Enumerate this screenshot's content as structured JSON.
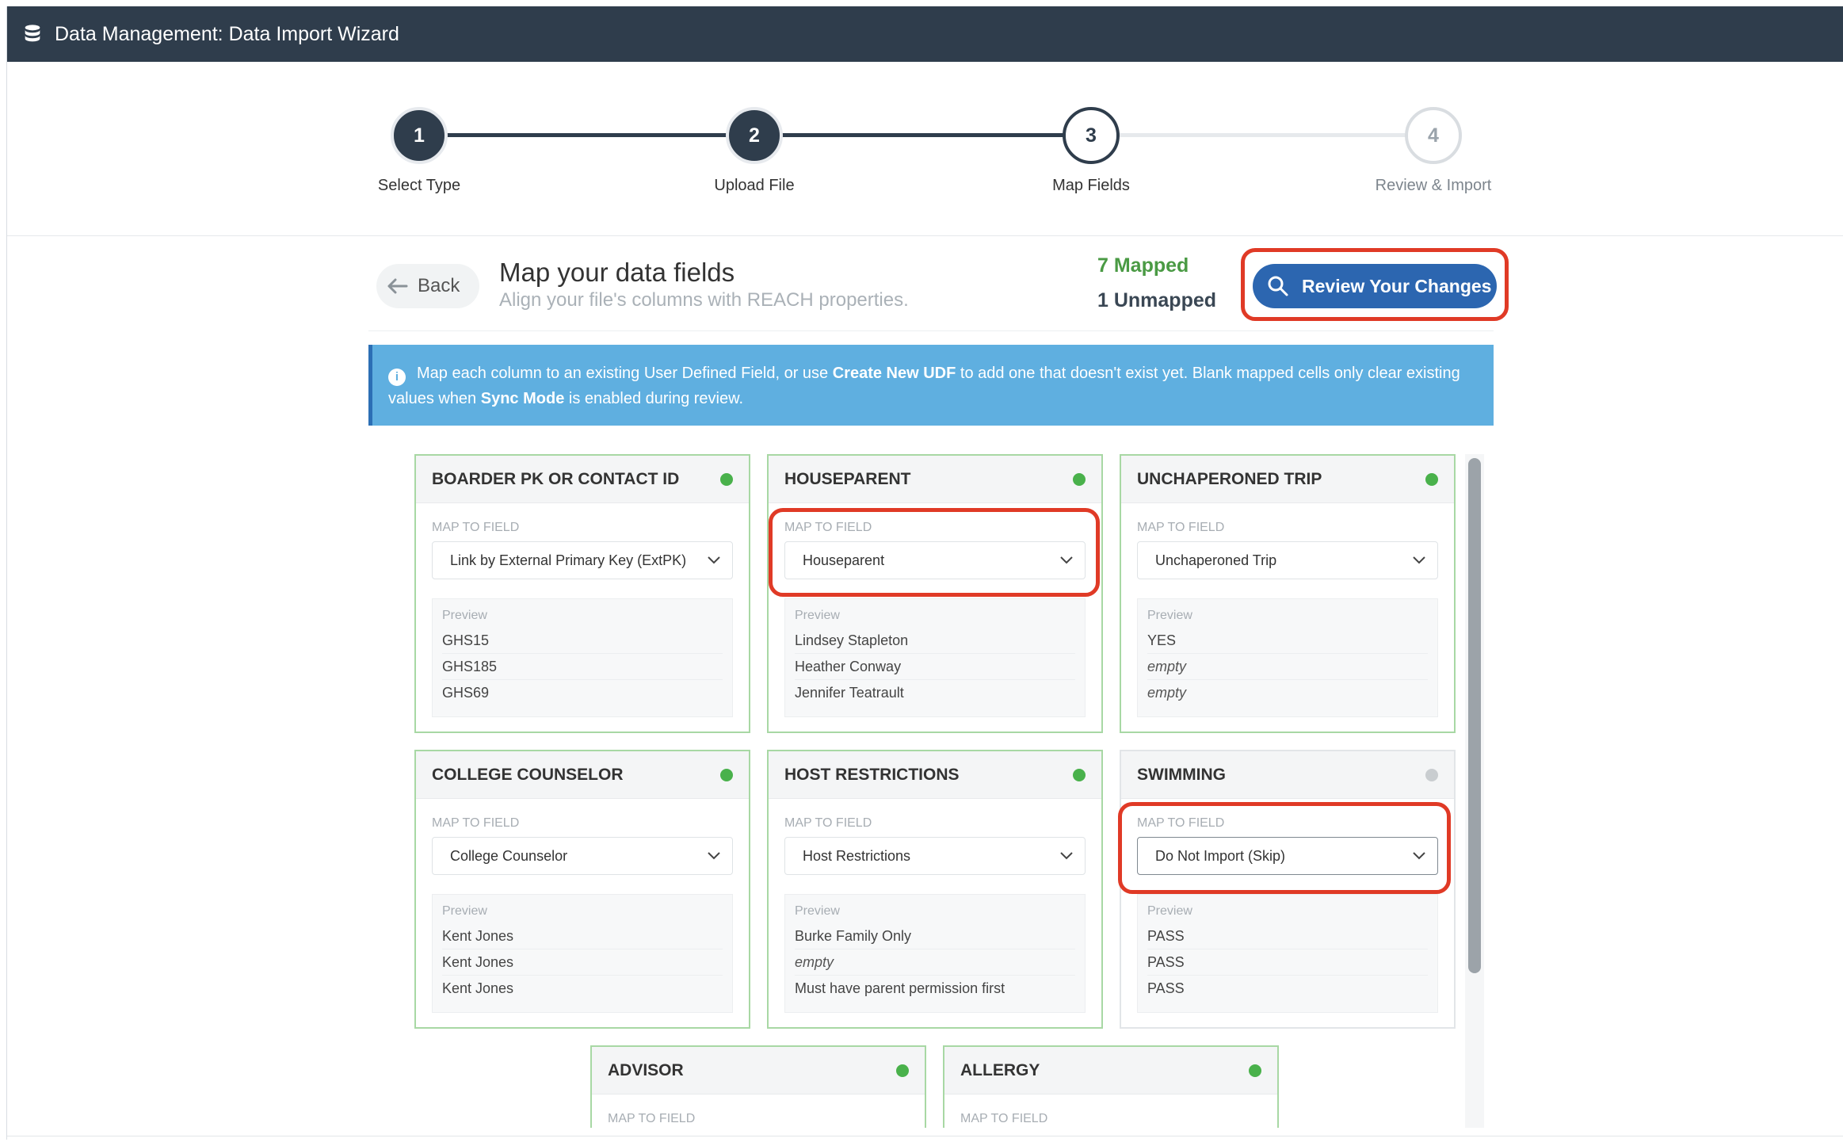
{
  "window": {
    "title": "Data Management: Data Import Wizard",
    "icon": "database-icon"
  },
  "steps": [
    {
      "number": "1",
      "label": "Select Type",
      "state": "done"
    },
    {
      "number": "2",
      "label": "Upload File",
      "state": "done"
    },
    {
      "number": "3",
      "label": "Map Fields",
      "state": "current"
    },
    {
      "number": "4",
      "label": "Review & Import",
      "state": "todo"
    }
  ],
  "header": {
    "back_label": "Back",
    "title": "Map your data fields",
    "subtitle": "Align your file's columns with REACH properties.",
    "mapped": "7 Mapped",
    "unmapped": "1 Unmapped",
    "review_label": "Review Your Changes"
  },
  "info": {
    "part1": "Map each column to an existing User Defined Field, or use ",
    "bold1": "Create New UDF",
    "part2": " to add one that doesn't exist yet. Blank mapped cells only clear existing values when ",
    "bold2": "Sync Mode",
    "part3": " is enabled during review."
  },
  "map_label": "MAP TO FIELD",
  "preview_label": "Preview",
  "cards": [
    {
      "title": "BOARDER PK OR CONTACT ID",
      "mapped": true,
      "field": "Link by External Primary Key (ExtPK)",
      "preview": [
        "GHS15",
        "GHS185",
        "GHS69"
      ]
    },
    {
      "title": "HOUSEPARENT",
      "mapped": true,
      "field": "Houseparent",
      "preview": [
        "Lindsey Stapleton",
        "Heather Conway",
        "Jennifer Teatrault"
      ]
    },
    {
      "title": "UNCHAPERONED TRIP",
      "mapped": true,
      "field": "Unchaperoned Trip",
      "preview": [
        "YES",
        "empty",
        "empty"
      ]
    },
    {
      "title": "COLLEGE COUNSELOR",
      "mapped": true,
      "field": "College Counselor",
      "preview": [
        "Kent Jones",
        "Kent Jones",
        "Kent Jones"
      ]
    },
    {
      "title": "HOST RESTRICTIONS",
      "mapped": true,
      "field": "Host Restrictions",
      "preview": [
        "Burke Family Only",
        "empty",
        "Must have parent permission first"
      ]
    },
    {
      "title": "SWIMMING",
      "mapped": false,
      "field": "Do Not Import (Skip)",
      "preview": [
        "PASS",
        "PASS",
        "PASS"
      ]
    },
    {
      "title": "ADVISOR",
      "mapped": true
    },
    {
      "title": "ALLERGY",
      "mapped": true
    }
  ],
  "colors": {
    "titlebar": "#2f3d4c",
    "accent": "#2c66b0",
    "mapped_green": "#49b14b",
    "highlight": "#e03a26",
    "banner": "#5fafe0"
  }
}
